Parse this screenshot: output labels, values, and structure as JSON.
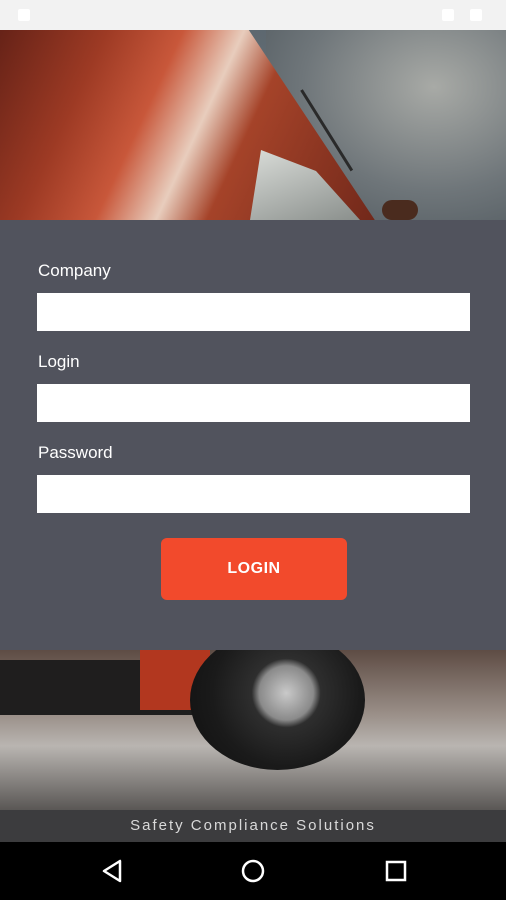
{
  "colors": {
    "panel": "#51535d",
    "accent": "#f24a2c",
    "footer": "#3c3c3e",
    "nav": "#000000"
  },
  "form": {
    "company_label": "Company",
    "company_value": "",
    "login_label": "Login",
    "login_value": "",
    "password_label": "Password",
    "password_value": "",
    "submit_label": "LOGIN"
  },
  "footer": {
    "tagline": "Safety Compliance Solutions"
  },
  "nav": {
    "icons": [
      "back-icon",
      "home-icon",
      "recents-icon"
    ]
  }
}
